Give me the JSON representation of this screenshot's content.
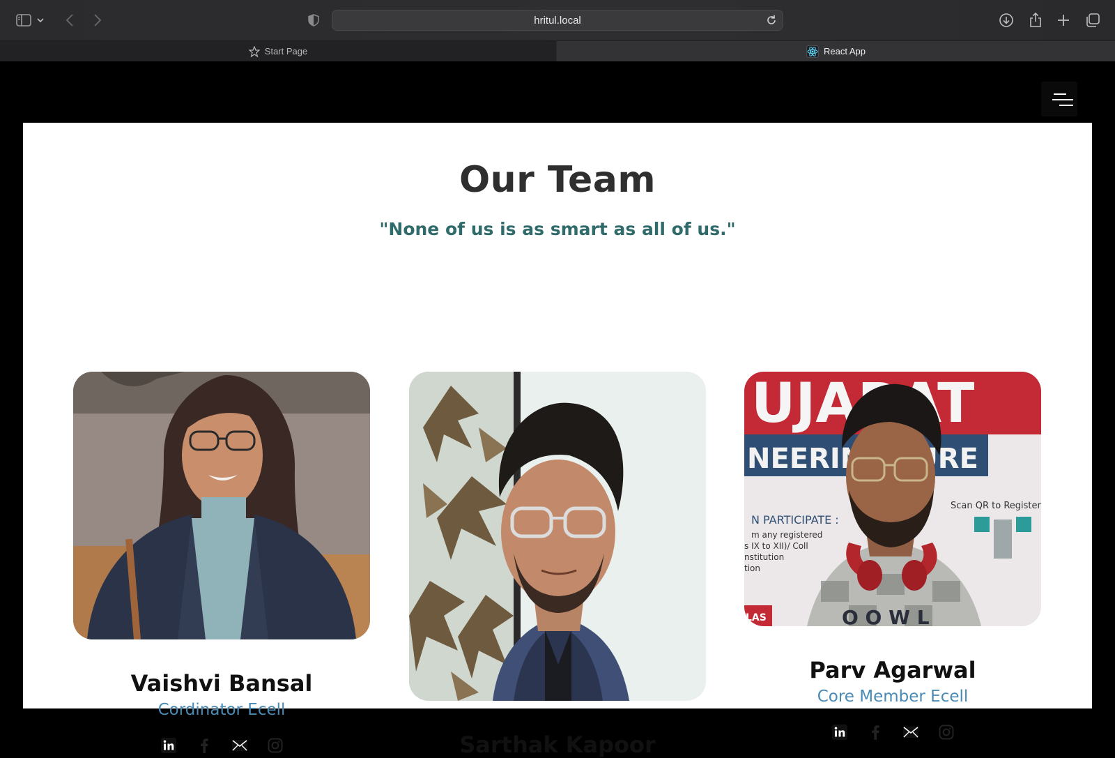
{
  "browser": {
    "url": "hritul.local",
    "tabs": [
      {
        "label": "Start Page",
        "active": false
      },
      {
        "label": "React App",
        "active": true
      }
    ]
  },
  "team": {
    "title": "Our Team",
    "quote": "\"None of us is as smart as all of us.\"",
    "members": [
      {
        "name": "Vaishvi Bansal",
        "role": "Cordinator Ecell"
      },
      {
        "name": "Sarthak Kapoor",
        "role": ""
      },
      {
        "name": "Parv Agarwal",
        "role": "Core Member Ecell"
      }
    ],
    "photo3_sign": {
      "brand_top": "UJARAT",
      "banner": "NEERING   TURE",
      "participate": "N PARTICIPATE :",
      "line1": "m any registered",
      "line2": "s IX to XII)/ Coll",
      "line3": "nstitution",
      "line4": "tion",
      "qr": "Scan QR to Register",
      "badge": "LAS",
      "shirt": "O O W L"
    }
  },
  "colors": {
    "page_bg": "#000000",
    "panel_bg": "#ffffff",
    "quote": "#2f6b6a",
    "role": "#4a8bb5"
  }
}
